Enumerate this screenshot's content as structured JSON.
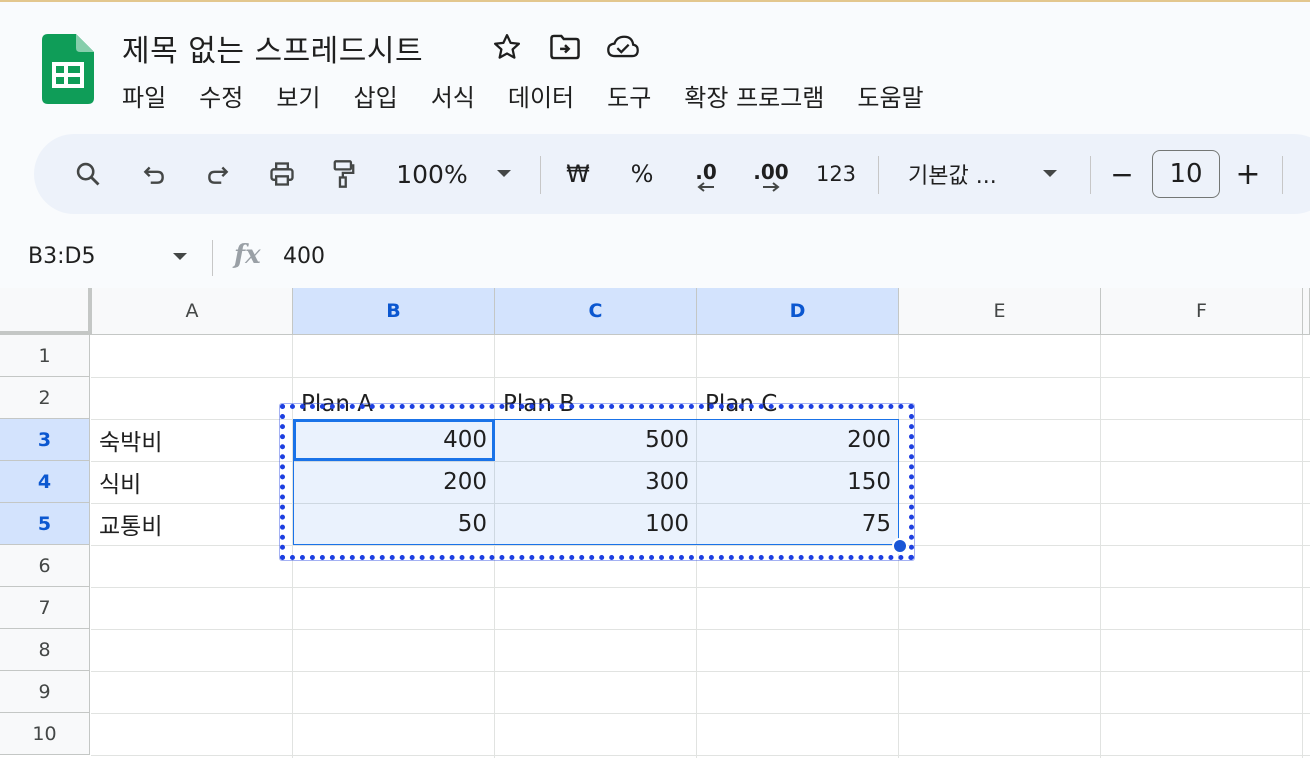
{
  "document": {
    "title": "제목 없는 스프레드시트"
  },
  "menu": [
    "파일",
    "수정",
    "보기",
    "삽입",
    "서식",
    "데이터",
    "도구",
    "확장 프로그램",
    "도움말"
  ],
  "toolbar": {
    "zoom": "100%",
    "currency": "₩",
    "percent": "%",
    "decrease_decimal": ".0",
    "increase_decimal": ".00",
    "number_format": "123",
    "font": "기본값 ...",
    "font_size": "10",
    "minus": "−",
    "plus": "+"
  },
  "formula_bar": {
    "name_box": "B3:D5",
    "fx": "fx",
    "value": "400"
  },
  "columns": [
    "A",
    "B",
    "C",
    "D",
    "E",
    "F"
  ],
  "rows": [
    "1",
    "2",
    "3",
    "4",
    "5",
    "6",
    "7",
    "8",
    "9",
    "10"
  ],
  "cells": {
    "B2": "Plan A",
    "C2": "Plan B",
    "D2": "Plan C",
    "A3": "숙박비",
    "B3": "400",
    "C3": "500",
    "D3": "200",
    "A4": "식비",
    "B4": "200",
    "C4": "300",
    "D4": "150",
    "A5": "교통비",
    "B5": "50",
    "C5": "100",
    "D5": "75"
  },
  "selection": {
    "range": "B3:D5",
    "active_cell": "B3"
  },
  "colors": {
    "accent": "#1a73e8",
    "selected_header": "#d3e3fd",
    "toolbar_bg": "#edf2fa",
    "logo_green": "#0f9d58",
    "annotation": "#1d3fe0"
  }
}
